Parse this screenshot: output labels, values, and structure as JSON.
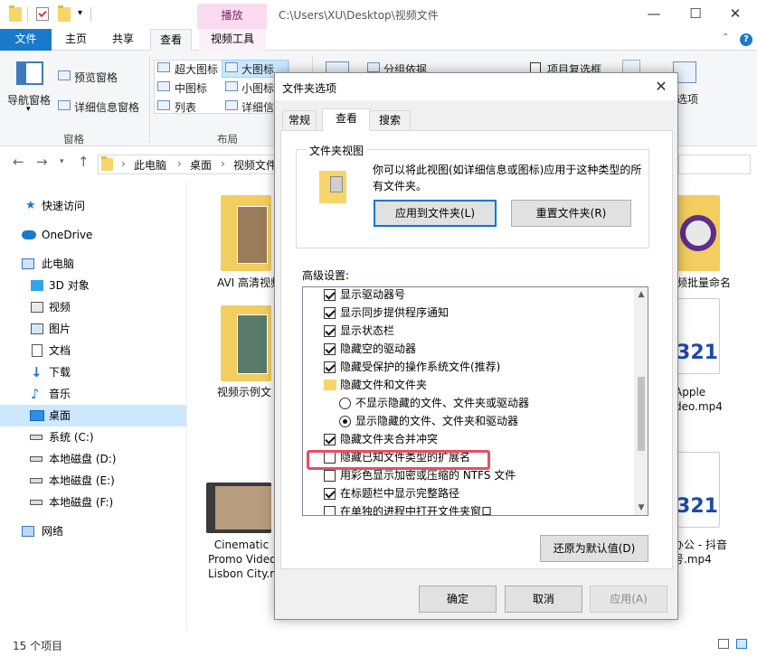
{
  "explorer": {
    "play_tab": "播放",
    "path_title": "C:\\Users\\XU\\Desktop\\视频文件",
    "window_controls": {
      "minimize": "—",
      "maximize": "☐",
      "close": "✕"
    },
    "ribbon_tabs": [
      "文件",
      "主页",
      "共享",
      "查看",
      "视频工具"
    ],
    "ribbon": {
      "nav_pane": "导航窗格",
      "preview_pane": "预览窗格",
      "details_pane": "详细信息窗格",
      "group_panes": "窗格",
      "layout_items": [
        "超大图标",
        "大图标",
        "中图标",
        "小图标",
        "列表",
        "详细信息"
      ],
      "group_layout": "布局",
      "group_by": "分组依据",
      "item_checkbox": "项目复选框",
      "options_partial": "选项"
    },
    "breadcrumbs": [
      "此电脑",
      "桌面",
      "视频文件"
    ],
    "sidebar": [
      {
        "label": "快速访问",
        "icon": "star-icon"
      },
      {
        "label": "OneDrive",
        "icon": "cloud-icon"
      },
      {
        "label": "此电脑",
        "icon": "computer-icon"
      },
      {
        "label": "3D 对象",
        "icon": "cube-icon"
      },
      {
        "label": "视频",
        "icon": "video-icon"
      },
      {
        "label": "图片",
        "icon": "picture-icon"
      },
      {
        "label": "文档",
        "icon": "document-icon"
      },
      {
        "label": "下载",
        "icon": "download-icon"
      },
      {
        "label": "音乐",
        "icon": "music-icon"
      },
      {
        "label": "桌面",
        "icon": "desktop-icon"
      },
      {
        "label": "系统 (C:)",
        "icon": "drive-icon"
      },
      {
        "label": "本地磁盘 (D:)",
        "icon": "drive-icon"
      },
      {
        "label": "本地磁盘 (E:)",
        "icon": "drive-icon"
      },
      {
        "label": "本地磁盘 (F:)",
        "icon": "drive-icon"
      },
      {
        "label": "网络",
        "icon": "network-icon"
      }
    ],
    "files": {
      "f1": "AVI 高清视频",
      "f2": "视频示例文",
      "f3_l1": "Cinematic",
      "f3_l2": "Promo Video",
      "f3_l3": "Lisbon City.m",
      "r1": "频批量命名",
      "r2_l1": "Apple",
      "r2_l2": "deo.mp4",
      "r3_l1": "办公 - 抖音",
      "r3_l2": "号.mp4"
    },
    "status": "15 个项目"
  },
  "dialog": {
    "title": "文件夹选项",
    "close": "✕",
    "tabs": [
      "常规",
      "查看",
      "搜索"
    ],
    "folder_view_legend": "文件夹视图",
    "folder_view_desc_l1": "你可以将此视图(如详细信息或图标)应用于这种类型的所",
    "folder_view_desc_l2": "有文件夹。",
    "apply_to_folders": "应用到文件夹(L)",
    "reset_folders": "重置文件夹(R)",
    "advanced_label": "高级设置:",
    "options": [
      {
        "type": "checkbox",
        "checked": true,
        "label": "显示驱动器号",
        "indent": 0
      },
      {
        "type": "checkbox",
        "checked": true,
        "label": "显示同步提供程序通知",
        "indent": 0
      },
      {
        "type": "checkbox",
        "checked": true,
        "label": "显示状态栏",
        "indent": 0
      },
      {
        "type": "checkbox",
        "checked": true,
        "label": "隐藏空的驱动器",
        "indent": 0
      },
      {
        "type": "checkbox",
        "checked": true,
        "label": "隐藏受保护的操作系统文件(推荐)",
        "indent": 0
      },
      {
        "type": "folder",
        "checked": false,
        "label": "隐藏文件和文件夹",
        "indent": 0
      },
      {
        "type": "radio",
        "checked": false,
        "label": "不显示隐藏的文件、文件夹或驱动器",
        "indent": 1
      },
      {
        "type": "radio",
        "checked": true,
        "label": "显示隐藏的文件、文件夹和驱动器",
        "indent": 1
      },
      {
        "type": "checkbox",
        "checked": true,
        "label": "隐藏文件夹合并冲突",
        "indent": 0
      },
      {
        "type": "checkbox",
        "checked": false,
        "label": "隐藏已知文件类型的扩展名",
        "indent": 0
      },
      {
        "type": "checkbox",
        "checked": false,
        "label": "用彩色显示加密或压缩的 NTFS 文件",
        "indent": 0
      },
      {
        "type": "checkbox",
        "checked": true,
        "label": "在标题栏中显示完整路径",
        "indent": 0
      },
      {
        "type": "checkbox",
        "checked": false,
        "label": "在单独的进程中打开文件夹窗口",
        "indent": 0
      }
    ],
    "restore_defaults": "还原为默认值(D)",
    "ok": "确定",
    "cancel": "取消",
    "apply": "应用(A)",
    "highlight_color": "#e84d63"
  }
}
